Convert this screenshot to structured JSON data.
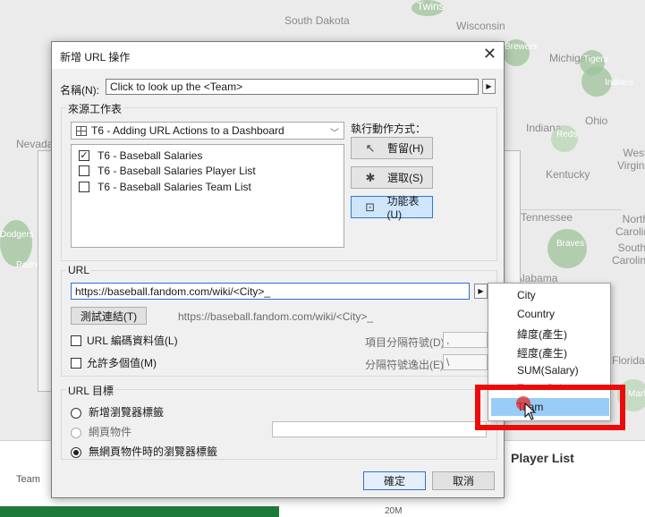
{
  "map": {
    "states": [
      "South Dakota",
      "Wisconsin",
      "Michigan",
      "Indiana",
      "Ohio",
      "West Virginia",
      "Kentucky",
      "Nevada",
      "Tennessee",
      "North Carolina",
      "South Carolina",
      "Alabama",
      "Florida"
    ],
    "team_labels": [
      "Twins",
      "Brewers",
      "Tigers",
      "Indians",
      "Reds",
      "Braves",
      "Dodgers",
      "Padres",
      "Marlins"
    ]
  },
  "background": {
    "player_list_title": "Player List",
    "team_header": "Team",
    "axis_tick": "20M"
  },
  "dialog": {
    "title": "新增 URL 操作",
    "name_label": "名稱(N):",
    "name_value": "Click to look up the <Team>",
    "source_sheets_title": "來源工作表",
    "source_dashboard": "T6 - Adding URL Actions to a Dashboard",
    "sheets": [
      {
        "label": "T6 - Baseball Salaries",
        "checked": true
      },
      {
        "label": "T6 - Baseball Salaries Player List",
        "checked": false
      },
      {
        "label": "T6 - Baseball Salaries Team List",
        "checked": false
      }
    ],
    "run_action_label": "執行動作方式：",
    "run_actions": [
      {
        "label": "暫留(H)",
        "icon": "hover-pointer-icon",
        "active": false
      },
      {
        "label": "選取(S)",
        "icon": "select-pointer-icon",
        "active": false
      },
      {
        "label": "功能表(U)",
        "icon": "menu-pointer-icon",
        "active": true
      }
    ],
    "url_title": "URL",
    "url_value": "https://baseball.fandom.com/wiki/<City>_",
    "test_link_button": "測試連結(T)",
    "url_preview": "https://baseball.fandom.com/wiki/<City>_",
    "encode_label": "URL 編碼資料值(L)",
    "allow_multi_label": "允許多個值(M)",
    "item_delimiter_label": "項目分隔符號(D):",
    "item_delimiter_value": ",",
    "delimiter_escape_label": "分隔符號逸出(E):",
    "delimiter_escape_value": "\\",
    "url_target_title": "URL 目標",
    "targets": [
      {
        "label": "新增瀏覽器標籤",
        "selected": false,
        "disabled": false
      },
      {
        "label": "網頁物件",
        "selected": false,
        "disabled": true
      },
      {
        "label": "無網頁物件時的瀏覽器標籤",
        "selected": true,
        "disabled": false
      }
    ],
    "ok_button": "確定",
    "cancel_button": "取消",
    "close_glyph": "✕",
    "arrow_glyph": "▶"
  },
  "field_menu": {
    "items": [
      "City",
      "Country",
      "緯度(產生)",
      "經度(產生)",
      "SUM(Salary)",
      "Team"
    ],
    "hidden_item_partial": "Team Salary",
    "selected": "Team"
  },
  "colors": {
    "highlight": "#ee0a0a",
    "menu_selected": "#99ccf7",
    "accent": "#2f6fd6"
  }
}
